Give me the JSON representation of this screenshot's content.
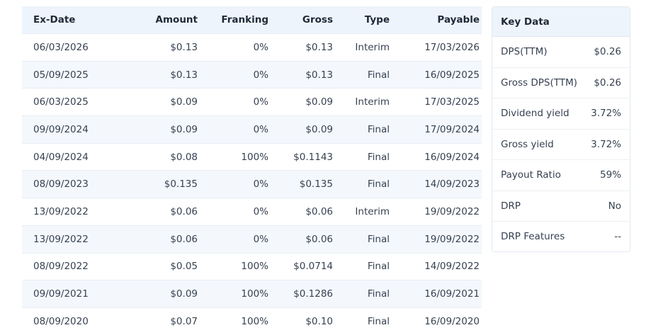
{
  "dividends": {
    "headers": {
      "ex_date": "Ex-Date",
      "amount": "Amount",
      "franking": "Franking",
      "gross": "Gross",
      "type": "Type",
      "payable": "Payable"
    },
    "rows": [
      {
        "ex_date": "06/03/2026",
        "amount": "$0.13",
        "franking": "0%",
        "gross": "$0.13",
        "type": "Interim",
        "payable": "17/03/2026"
      },
      {
        "ex_date": "05/09/2025",
        "amount": "$0.13",
        "franking": "0%",
        "gross": "$0.13",
        "type": "Final",
        "payable": "16/09/2025"
      },
      {
        "ex_date": "06/03/2025",
        "amount": "$0.09",
        "franking": "0%",
        "gross": "$0.09",
        "type": "Interim",
        "payable": "17/03/2025"
      },
      {
        "ex_date": "09/09/2024",
        "amount": "$0.09",
        "franking": "0%",
        "gross": "$0.09",
        "type": "Final",
        "payable": "17/09/2024"
      },
      {
        "ex_date": "04/09/2024",
        "amount": "$0.08",
        "franking": "100%",
        "gross": "$0.1143",
        "type": "Final",
        "payable": "16/09/2024"
      },
      {
        "ex_date": "08/09/2023",
        "amount": "$0.135",
        "franking": "0%",
        "gross": "$0.135",
        "type": "Final",
        "payable": "14/09/2023"
      },
      {
        "ex_date": "13/09/2022",
        "amount": "$0.06",
        "franking": "0%",
        "gross": "$0.06",
        "type": "Interim",
        "payable": "19/09/2022"
      },
      {
        "ex_date": "13/09/2022",
        "amount": "$0.06",
        "franking": "0%",
        "gross": "$0.06",
        "type": "Final",
        "payable": "19/09/2022"
      },
      {
        "ex_date": "08/09/2022",
        "amount": "$0.05",
        "franking": "100%",
        "gross": "$0.0714",
        "type": "Final",
        "payable": "14/09/2022"
      },
      {
        "ex_date": "09/09/2021",
        "amount": "$0.09",
        "franking": "100%",
        "gross": "$0.1286",
        "type": "Final",
        "payable": "16/09/2021"
      },
      {
        "ex_date": "08/09/2020",
        "amount": "$0.07",
        "franking": "100%",
        "gross": "$0.10",
        "type": "Final",
        "payable": "16/09/2020"
      }
    ]
  },
  "key_data": {
    "title": "Key Data",
    "items": [
      {
        "label": "DPS(TTM)",
        "value": "$0.26"
      },
      {
        "label": "Gross DPS(TTM)",
        "value": "$0.26"
      },
      {
        "label": "Dividend yield",
        "value": "3.72%"
      },
      {
        "label": "Gross yield",
        "value": "3.72%"
      },
      {
        "label": "Payout Ratio",
        "value": "59%"
      },
      {
        "label": "DRP",
        "value": "No"
      },
      {
        "label": "DRP Features",
        "value": "--"
      }
    ]
  }
}
